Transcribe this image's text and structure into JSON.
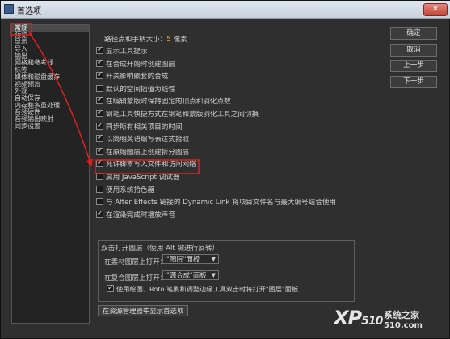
{
  "window": {
    "title": "首选项",
    "close_label": "✕"
  },
  "nav": {
    "items": [
      "常规",
      "预览",
      "显示",
      "导入",
      "输出",
      "网格和参考线",
      "标签",
      "媒体和磁盘缓存",
      "视频预览",
      "外观",
      "自动保存",
      "内存和多重处理",
      "音频硬件",
      "音频输出映射",
      "同步设置"
    ],
    "selected_index": 0
  },
  "general": {
    "path_size_label": "路径点和手柄大小：",
    "path_size_value": "5",
    "path_size_unit": "像素",
    "options": [
      {
        "label": "显示工具提示",
        "checked": true,
        "enabled": true
      },
      {
        "label": "在合成开始时创建图层",
        "checked": true,
        "enabled": true
      },
      {
        "label": "开关影响嵌套的合成",
        "checked": true,
        "enabled": true
      },
      {
        "label": "默认的空间插值为线性",
        "checked": false,
        "enabled": true
      },
      {
        "label": "在编辑蒙版时保持固定的顶点和羽化点数",
        "checked": true,
        "enabled": true
      },
      {
        "label": "钢笔工具快捷方式在钢笔和蒙版羽化工具之间切换",
        "checked": true,
        "enabled": true
      },
      {
        "label": "同步所有相关项目的时间",
        "checked": true,
        "enabled": true
      },
      {
        "label": "以简明英语编写表达式拾取",
        "checked": true,
        "enabled": true
      },
      {
        "label": "在原始图层上创建拆分图层",
        "checked": true,
        "enabled": true
      },
      {
        "label": "允许脚本写入文件和访问网络",
        "checked": true,
        "enabled": true
      },
      {
        "label": "启用 JavaScript 调试器",
        "checked": false,
        "enabled": true
      },
      {
        "label": "使用系统拾色器",
        "checked": false,
        "enabled": true
      },
      {
        "label": "与 After Effects 链接的 Dynamic Link 将项目文件名与最大编号结合使用",
        "checked": false,
        "enabled": true
      },
      {
        "label": "在渲染完成时播放声音",
        "checked": true,
        "enabled": true
      }
    ]
  },
  "buttons": {
    "ok": "确定",
    "cancel": "取消",
    "prev": "上一步",
    "next": "下一步"
  },
  "double_click": {
    "title": "双击打开图层（使用 Alt 键进行反转）",
    "footage_label": "在素材图层上打开：",
    "footage_value": "\"图层\"面板",
    "comp_label": "在复合图层上打开：",
    "comp_value": "\"源合成\"面板",
    "roto_label": "使用绘图、Roto 笔刷和调整边缘工具双击时将打开\"图层\"面板",
    "roto_checked": true
  },
  "footer": {
    "reveal_button": "在资源管理器中显示首选项"
  },
  "watermark": {
    "logo": "XP",
    "logo_suffix": "510",
    "site_name": "系统之家",
    "url": "510.com"
  },
  "colors": {
    "highlight": "#e02020",
    "accent_number": "#f3b033"
  }
}
